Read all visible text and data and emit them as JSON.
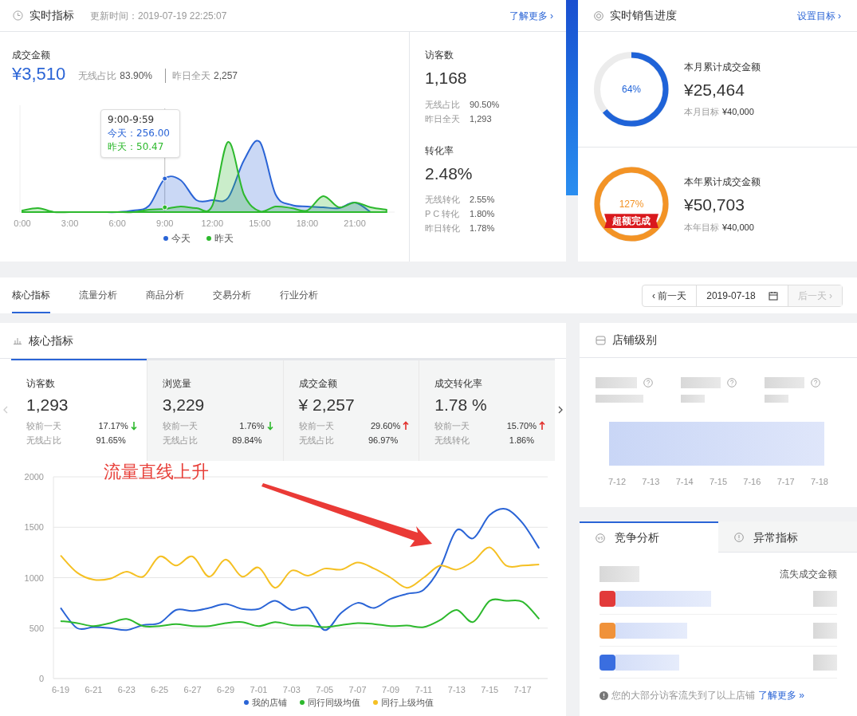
{
  "realtime": {
    "title": "实时指标",
    "updated": "更新时间：2019-07-19 22:25:07",
    "link": "了解更多 ›",
    "sales": {
      "label": "成交金额",
      "value": "¥3,510",
      "stats": [
        {
          "label": "无线占比",
          "value": "83.90%"
        },
        {
          "label": "昨日全天",
          "value": "2,257"
        }
      ]
    },
    "chart": {
      "xticks": [
        "0:00",
        "3:00",
        "6:00",
        "9:00",
        "12:00",
        "15:00",
        "18:00",
        "21:00"
      ],
      "legend": [
        {
          "label": "今天",
          "color": "#2a64d6"
        },
        {
          "label": "昨天",
          "color": "#2db92d"
        }
      ],
      "tooltip": {
        "title": "9:00-9:59",
        "lines": [
          {
            "text": "今天：256.00",
            "color": "#2a64d6"
          },
          {
            "text": "昨天：50.47",
            "color": "#2db92d"
          }
        ]
      }
    },
    "side": [
      {
        "label": "访客数",
        "value": "1,168",
        "stats": [
          {
            "label": "无线占比",
            "value": "90.50%"
          },
          {
            "label": "昨日全天",
            "value": "1,293"
          }
        ]
      },
      {
        "label": "转化率",
        "value": "2.48%",
        "stats": [
          {
            "label": "无线转化",
            "value": "2.55%"
          },
          {
            "label": "P C 转化",
            "value": "1.80%"
          },
          {
            "label": "昨日转化",
            "value": "1.78%"
          }
        ]
      }
    ]
  },
  "progress": {
    "title": "实时销售进度",
    "link": "设置目标 ›",
    "items": [
      {
        "percent": "64%",
        "level": 0.64,
        "color": "#1f63d8",
        "title": "本月累计成交金额",
        "value": "¥25,464",
        "target_label": "本月目标",
        "target_value": "¥40,000"
      },
      {
        "percent": "127%",
        "level": 1,
        "color": "#f39325",
        "badge": "超额完成",
        "title": "本年累计成交金额",
        "value": "¥50,703",
        "target_label": "本年目标",
        "target_value": "¥40,000"
      }
    ]
  },
  "tabs": [
    {
      "label": "核心指标",
      "selected": true
    },
    {
      "label": "流量分析",
      "selected": false
    },
    {
      "label": "商品分析",
      "selected": false
    },
    {
      "label": "交易分析",
      "selected": false
    },
    {
      "label": "行业分析",
      "selected": false
    }
  ],
  "date_nav": {
    "prev": "‹ 前一天",
    "date": "2019-07-18",
    "next": "后一天 ›",
    "next_disabled": true
  },
  "core": {
    "title": "核心指标",
    "cards": [
      {
        "label": "访客数",
        "value": "1,293",
        "selected": true,
        "rows": [
          {
            "label": "较前一天",
            "value": "17.17%",
            "rising": false
          },
          {
            "label": "无线占比",
            "value": "91.65%"
          }
        ]
      },
      {
        "label": "浏览量",
        "value": "3,229",
        "selected": false,
        "rows": [
          {
            "label": "较前一天",
            "value": "1.76%",
            "rising": false
          },
          {
            "label": "无线占比",
            "value": "89.84%"
          }
        ]
      },
      {
        "label": "成交金额",
        "value": "¥ 2,257",
        "selected": false,
        "rows": [
          {
            "label": "较前一天",
            "value": "29.60%",
            "rising": true
          },
          {
            "label": "无线占比",
            "value": "96.97%"
          }
        ]
      },
      {
        "label": "成交转化率",
        "value": "1.78 %",
        "selected": false,
        "rows": [
          {
            "label": "较前一天",
            "value": "15.70%",
            "rising": true
          },
          {
            "label": "无线转化",
            "value": "1.86%"
          }
        ]
      }
    ],
    "annotation": "流量直线上升",
    "chart_data": {
      "type": "line",
      "categories": [
        "6-19",
        null,
        "6-21",
        null,
        "6-23",
        null,
        "6-25",
        null,
        "6-27",
        null,
        "6-29",
        null,
        "7-01",
        null,
        "7-03",
        null,
        "7-05",
        null,
        "7-07",
        null,
        "7-09",
        null,
        "7-11",
        null,
        "7-13",
        null,
        "7-15",
        null,
        "7-17",
        null
      ],
      "yticks": [
        0,
        500,
        1000,
        1500,
        2000
      ],
      "ylim": [
        0,
        2000
      ],
      "grid": true,
      "series": [
        {
          "name": "我的店铺",
          "color": "#2a64d6",
          "values": [
            700,
            500,
            510,
            500,
            480,
            530,
            550,
            680,
            670,
            700,
            740,
            690,
            690,
            770,
            680,
            700,
            480,
            650,
            750,
            700,
            790,
            840,
            880,
            1100,
            1470,
            1390,
            1620,
            1680,
            1540,
            1290
          ]
        },
        {
          "name": "同行同级均值",
          "color": "#2db92d",
          "values": [
            570,
            550,
            520,
            550,
            590,
            520,
            520,
            540,
            520,
            520,
            550,
            560,
            520,
            560,
            530,
            525,
            510,
            530,
            550,
            540,
            520,
            525,
            510,
            580,
            680,
            560,
            770,
            770,
            760,
            590
          ]
        },
        {
          "name": "同行上级均值",
          "color": "#f5c023",
          "values": [
            1220,
            1050,
            980,
            990,
            1060,
            1010,
            1210,
            1120,
            1210,
            1010,
            1180,
            1010,
            1100,
            900,
            1070,
            1020,
            1090,
            1080,
            1150,
            1090,
            1000,
            900,
            1000,
            1120,
            1080,
            1160,
            1300,
            1120,
            1120,
            1130
          ]
        }
      ]
    }
  },
  "store_level": {
    "title": "店铺级别",
    "dates": [
      "7-12",
      "7-13",
      "7-14",
      "7-15",
      "7-16",
      "7-17",
      "7-18"
    ]
  },
  "competition": {
    "tabs": [
      {
        "label": "竞争分析",
        "selected": true
      },
      {
        "label": "异常指标",
        "selected": false
      }
    ],
    "column": "流失成交金额",
    "rows": [
      {
        "color": "#e23a3a"
      },
      {
        "color": "#f0923a"
      },
      {
        "color": "#3a6ee0"
      }
    ],
    "note": "您的大部分访客流失到了以上店铺",
    "link": "了解更多 »"
  }
}
